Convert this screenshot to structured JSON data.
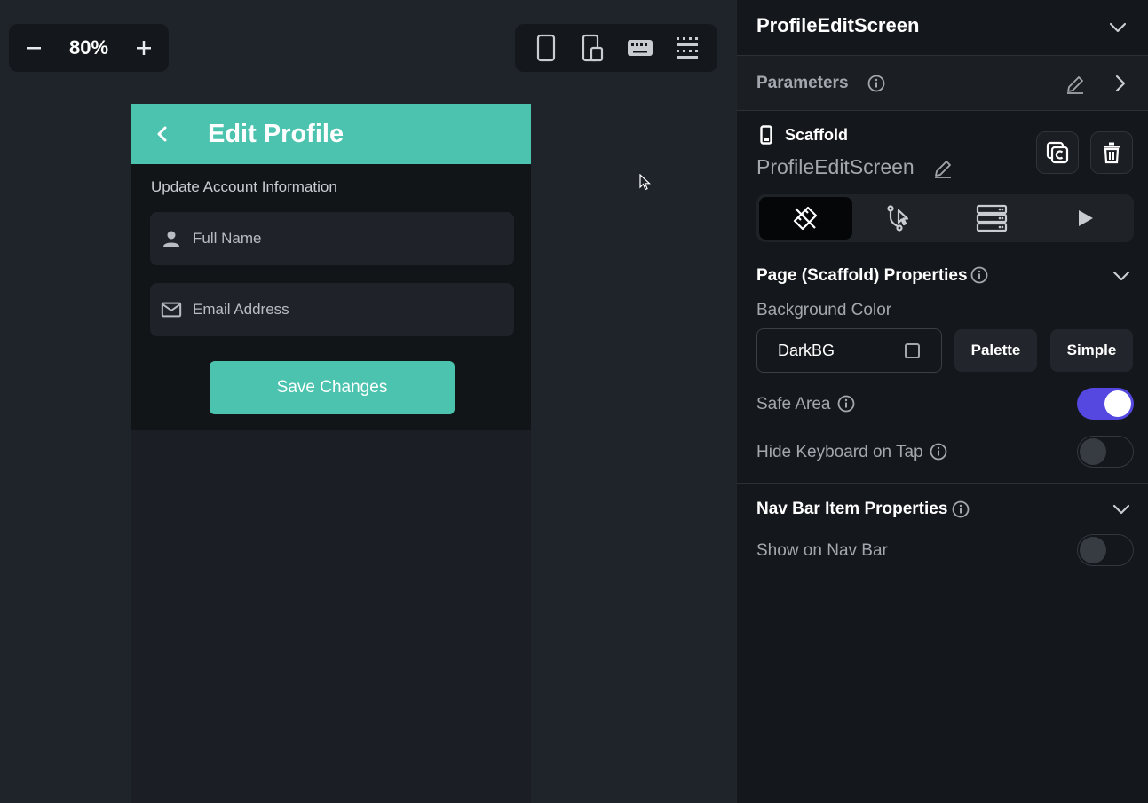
{
  "canvas": {
    "zoom": {
      "minus_icon": "minus-icon",
      "value": "80%",
      "plus_icon": "plus-icon"
    },
    "device_toolbar": [
      "phone-icon",
      "tablet-phone-icon",
      "keyboard-icon",
      "grid-icon"
    ]
  },
  "preview": {
    "appbar": {
      "back_icon": "chevron-left-icon",
      "title": "Edit Profile"
    },
    "subheading": "Update Account Information",
    "fields": [
      {
        "icon": "person-icon",
        "placeholder": "Full Name"
      },
      {
        "icon": "mail-icon",
        "placeholder": "Email Address"
      }
    ],
    "save_button": "Save Changes"
  },
  "panel": {
    "title": "ProfileEditScreen",
    "parameters_label": "Parameters",
    "widget_type": "Scaffold",
    "widget_name": "ProfileEditScreen",
    "tabs": [
      "properties-icon",
      "actions-icon",
      "backend-query-icon",
      "preview-icon"
    ],
    "page_properties": {
      "title": "Page (Scaffold) Properties",
      "background_color_label": "Background Color",
      "background_color_value": "DarkBG",
      "palette_button": "Palette",
      "simple_button": "Simple",
      "safe_area_label": "Safe Area",
      "safe_area_on": true,
      "hide_keyboard_label": "Hide Keyboard on Tap",
      "hide_keyboard_on": false
    },
    "nav_bar": {
      "title": "Nav Bar Item Properties",
      "show_on_nav_label": "Show on Nav Bar",
      "show_on_nav_on": false
    }
  },
  "colors": {
    "accent_teal": "#4cc3ae",
    "toggle_on": "#5448e0",
    "panel_bg": "#14171b",
    "canvas_bg": "#1f232a"
  }
}
